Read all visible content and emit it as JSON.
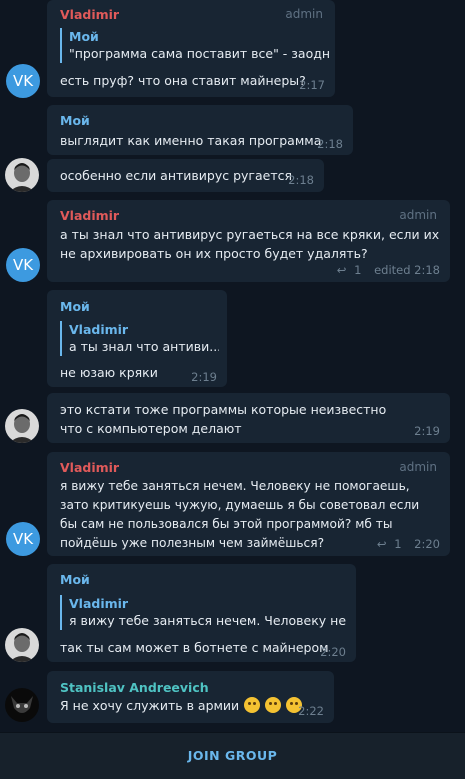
{
  "messages": {
    "m1": {
      "author": "Vladimir",
      "badge": "admin",
      "reply_name": "Мой",
      "reply_text": "\"программа сама поставит все\" - заодн...",
      "text": "есть пруф? что она ставит майнеры?",
      "time": "2:17"
    },
    "m2": {
      "author": "Мой",
      "text": "выглядит как именно такая программа",
      "time": "2:18"
    },
    "m3": {
      "text": "особенно если антивирус ругается",
      "time": "2:18"
    },
    "m4": {
      "author": "Vladimir",
      "badge": "admin",
      "text": "а ты знал что антивирус ругаеться на все кряки, если их не архивировать он их просто будет удалять?",
      "replies": "1",
      "edited": "edited 2:18"
    },
    "m5": {
      "author": "Мой",
      "reply_name": "Vladimir",
      "reply_text": "а ты знал что антиви...",
      "text": "не юзаю кряки",
      "time": "2:19"
    },
    "m6": {
      "text": "это кстати тоже программы которые неизвестно что с компьютером делают",
      "time": "2:19"
    },
    "m7": {
      "author": "Vladimir",
      "badge": "admin",
      "text": "я вижу тебе заняться нечем. Человеку не помогаешь, зато критикуешь чужую, думаешь я бы советовал если бы сам не пользовался бы этой программой? мб ты пойдёшь уже полезным чем займёшься?",
      "replies": "1",
      "time": "2:20"
    },
    "m8": {
      "author": "Мой",
      "reply_name": "Vladimir",
      "reply_text": "я вижу тебе заняться нечем. Человеку не ...",
      "text": "так ты сам может в ботнете с майнером",
      "time": "2:20"
    },
    "m9": {
      "author": "Stanislav Andreevich",
      "text": "Я не хочу служить в армии",
      "time": "2:22"
    }
  },
  "avatars": {
    "vk_label": "VK"
  },
  "bottom": {
    "join_label": "JOIN GROUP"
  },
  "colors": {
    "background": "#0e1621",
    "bubble": "#182533",
    "accent": "#6ab7ec",
    "admin_name": "#e05a5a",
    "vk_avatar": "#3d9ae0"
  }
}
